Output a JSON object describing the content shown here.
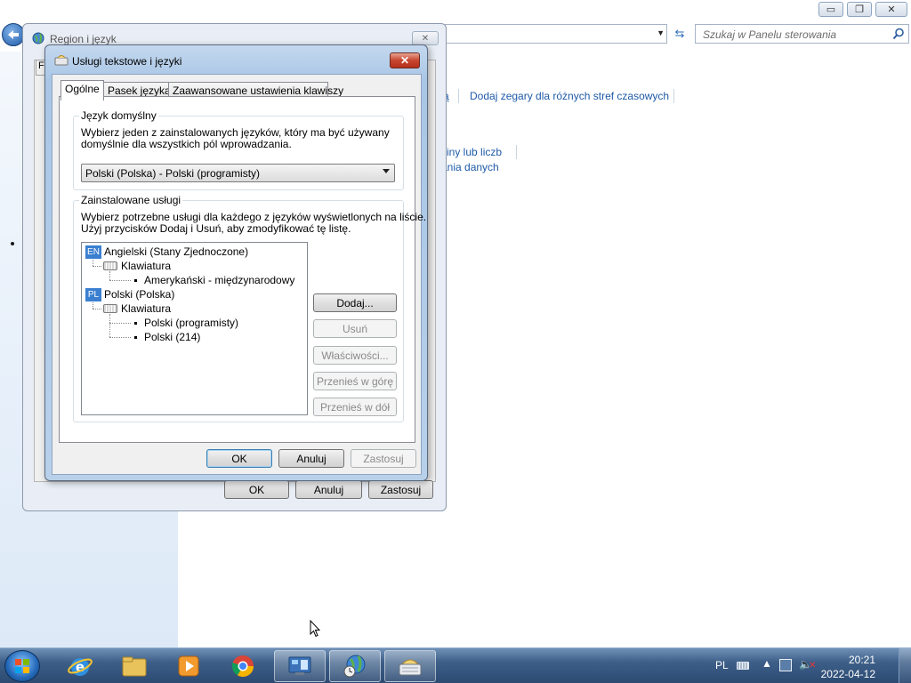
{
  "control_panel": {
    "search_placeholder": "Szukaj w Panelu sterowania",
    "links": {
      "link_fragment_top": "ą",
      "add_clocks": "Dodaj zegary dla różnych stref czasowych",
      "link_fragment_2": "ziny lub liczb",
      "link_fragment_3": "ania danych"
    },
    "title_buttons": {
      "minimize": "▭",
      "maximize": "❐",
      "close": "✕"
    }
  },
  "region_dialog": {
    "title": "Region i język",
    "tab_stub": "F",
    "buttons": {
      "ok": "OK",
      "cancel": "Anuluj",
      "apply": "Zastosuj"
    }
  },
  "text_services_dialog": {
    "title": "Usługi tekstowe i języki",
    "close_glyph": "✕",
    "tabs": [
      {
        "label": "Ogólne",
        "active": true
      },
      {
        "label": "Pasek języka",
        "active": false
      },
      {
        "label": "Zaawansowane ustawienia klawiszy",
        "active": false
      }
    ],
    "default_language": {
      "label": "Język domyślny",
      "description_line1": "Wybierz jeden z zainstalowanych języków, który ma być używany",
      "description_line2": "domyślnie dla wszystkich pól wprowadzania.",
      "selected": "Polski (Polska) - Polski (programisty)"
    },
    "installed_services": {
      "label": "Zainstalowane usługi",
      "description_line1": "Wybierz potrzebne usługi dla każdego z języków wyświetlonych na liście.",
      "description_line2": "Użyj przycisków Dodaj i Usuń, aby zmodyfikować tę listę.",
      "tree": {
        "lang1_badge": "EN",
        "lang1": "Angielski (Stany Zjednoczone)",
        "lang1_group": "Klawiatura",
        "lang1_item1": "Amerykański - międzynarodowy",
        "lang2_badge": "PL",
        "lang2": "Polski (Polska)",
        "lang2_group": "Klawiatura",
        "lang2_item1": "Polski (programisty)",
        "lang2_item2": "Polski (214)"
      },
      "buttons": {
        "add": "Dodaj...",
        "remove": "Usuń",
        "properties": "Właściwości...",
        "move_up": "Przenieś w górę",
        "move_down": "Przenieś w dół"
      }
    },
    "footer_buttons": {
      "ok": "OK",
      "cancel": "Anuluj",
      "apply": "Zastosuj"
    }
  },
  "taskbar": {
    "tray_language": "PL",
    "clock_time": "20:21",
    "clock_date": "2022-04-12"
  }
}
